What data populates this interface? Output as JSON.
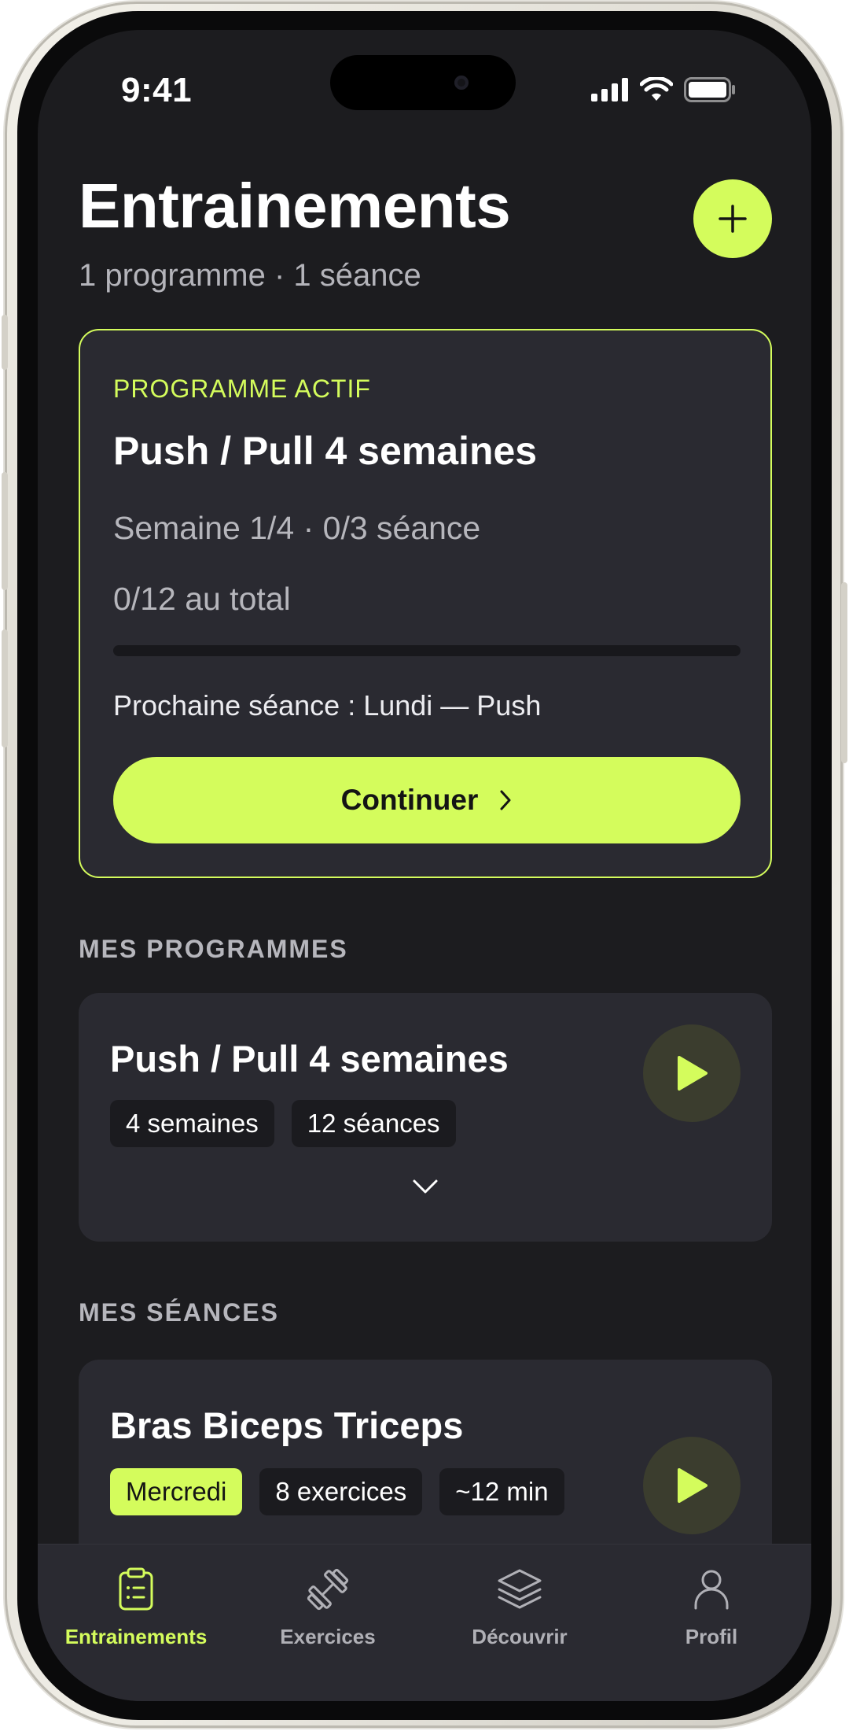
{
  "status_bar": {
    "time": "9:41"
  },
  "header": {
    "title": "Entrainements",
    "subtitle": "1 programme · 1 séance"
  },
  "active_program": {
    "label": "PROGRAMME ACTIF",
    "name": "Push / Pull 4 semaines",
    "week_progress": "Semaine 1/4 · 0/3 séance",
    "total_progress": "0/12 au total",
    "progress_fraction": 0,
    "next_session": "Prochaine séance : Lundi — Push",
    "continue_label": "Continuer"
  },
  "programs_section": {
    "heading": "MES PROGRAMMES",
    "items": [
      {
        "title": "Push / Pull 4 semaines",
        "chips": [
          "4 semaines",
          "12 séances"
        ]
      }
    ]
  },
  "sessions_section": {
    "heading": "MES SÉANCES",
    "items": [
      {
        "title": "Bras Biceps Triceps",
        "chips": [
          "Mercredi",
          "8 exercices",
          "~12 min"
        ]
      }
    ]
  },
  "tab_bar": {
    "items": [
      {
        "label": "Entrainements",
        "icon": "clipboard-icon",
        "active": true
      },
      {
        "label": "Exercices",
        "icon": "dumbbell-icon",
        "active": false
      },
      {
        "label": "Découvrir",
        "icon": "layers-icon",
        "active": false
      },
      {
        "label": "Profil",
        "icon": "person-icon",
        "active": false
      }
    ]
  },
  "colors": {
    "accent": "#d4fc5c",
    "background": "#1c1c1f",
    "card": "#2a2a31"
  }
}
